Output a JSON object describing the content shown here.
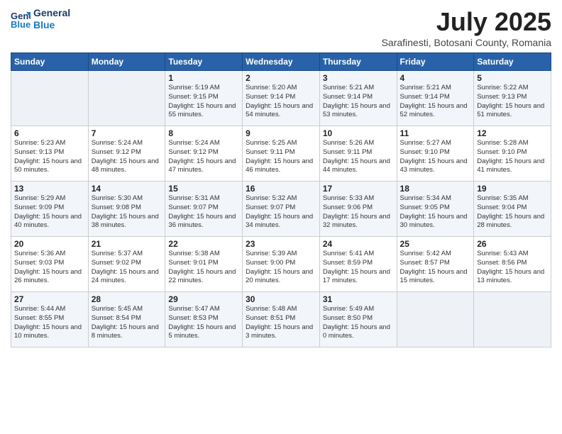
{
  "header": {
    "logo_line1": "General",
    "logo_line2": "Blue",
    "title": "July 2025",
    "location": "Sarafinesti, Botosani County, Romania"
  },
  "weekdays": [
    "Sunday",
    "Monday",
    "Tuesday",
    "Wednesday",
    "Thursday",
    "Friday",
    "Saturday"
  ],
  "weeks": [
    [
      {
        "day": null
      },
      {
        "day": null
      },
      {
        "day": "1",
        "sunrise": "Sunrise: 5:19 AM",
        "sunset": "Sunset: 9:15 PM",
        "daylight": "Daylight: 15 hours and 55 minutes."
      },
      {
        "day": "2",
        "sunrise": "Sunrise: 5:20 AM",
        "sunset": "Sunset: 9:14 PM",
        "daylight": "Daylight: 15 hours and 54 minutes."
      },
      {
        "day": "3",
        "sunrise": "Sunrise: 5:21 AM",
        "sunset": "Sunset: 9:14 PM",
        "daylight": "Daylight: 15 hours and 53 minutes."
      },
      {
        "day": "4",
        "sunrise": "Sunrise: 5:21 AM",
        "sunset": "Sunset: 9:14 PM",
        "daylight": "Daylight: 15 hours and 52 minutes."
      },
      {
        "day": "5",
        "sunrise": "Sunrise: 5:22 AM",
        "sunset": "Sunset: 9:13 PM",
        "daylight": "Daylight: 15 hours and 51 minutes."
      }
    ],
    [
      {
        "day": "6",
        "sunrise": "Sunrise: 5:23 AM",
        "sunset": "Sunset: 9:13 PM",
        "daylight": "Daylight: 15 hours and 50 minutes."
      },
      {
        "day": "7",
        "sunrise": "Sunrise: 5:24 AM",
        "sunset": "Sunset: 9:12 PM",
        "daylight": "Daylight: 15 hours and 48 minutes."
      },
      {
        "day": "8",
        "sunrise": "Sunrise: 5:24 AM",
        "sunset": "Sunset: 9:12 PM",
        "daylight": "Daylight: 15 hours and 47 minutes."
      },
      {
        "day": "9",
        "sunrise": "Sunrise: 5:25 AM",
        "sunset": "Sunset: 9:11 PM",
        "daylight": "Daylight: 15 hours and 46 minutes."
      },
      {
        "day": "10",
        "sunrise": "Sunrise: 5:26 AM",
        "sunset": "Sunset: 9:11 PM",
        "daylight": "Daylight: 15 hours and 44 minutes."
      },
      {
        "day": "11",
        "sunrise": "Sunrise: 5:27 AM",
        "sunset": "Sunset: 9:10 PM",
        "daylight": "Daylight: 15 hours and 43 minutes."
      },
      {
        "day": "12",
        "sunrise": "Sunrise: 5:28 AM",
        "sunset": "Sunset: 9:10 PM",
        "daylight": "Daylight: 15 hours and 41 minutes."
      }
    ],
    [
      {
        "day": "13",
        "sunrise": "Sunrise: 5:29 AM",
        "sunset": "Sunset: 9:09 PM",
        "daylight": "Daylight: 15 hours and 40 minutes."
      },
      {
        "day": "14",
        "sunrise": "Sunrise: 5:30 AM",
        "sunset": "Sunset: 9:08 PM",
        "daylight": "Daylight: 15 hours and 38 minutes."
      },
      {
        "day": "15",
        "sunrise": "Sunrise: 5:31 AM",
        "sunset": "Sunset: 9:07 PM",
        "daylight": "Daylight: 15 hours and 36 minutes."
      },
      {
        "day": "16",
        "sunrise": "Sunrise: 5:32 AM",
        "sunset": "Sunset: 9:07 PM",
        "daylight": "Daylight: 15 hours and 34 minutes."
      },
      {
        "day": "17",
        "sunrise": "Sunrise: 5:33 AM",
        "sunset": "Sunset: 9:06 PM",
        "daylight": "Daylight: 15 hours and 32 minutes."
      },
      {
        "day": "18",
        "sunrise": "Sunrise: 5:34 AM",
        "sunset": "Sunset: 9:05 PM",
        "daylight": "Daylight: 15 hours and 30 minutes."
      },
      {
        "day": "19",
        "sunrise": "Sunrise: 5:35 AM",
        "sunset": "Sunset: 9:04 PM",
        "daylight": "Daylight: 15 hours and 28 minutes."
      }
    ],
    [
      {
        "day": "20",
        "sunrise": "Sunrise: 5:36 AM",
        "sunset": "Sunset: 9:03 PM",
        "daylight": "Daylight: 15 hours and 26 minutes."
      },
      {
        "day": "21",
        "sunrise": "Sunrise: 5:37 AM",
        "sunset": "Sunset: 9:02 PM",
        "daylight": "Daylight: 15 hours and 24 minutes."
      },
      {
        "day": "22",
        "sunrise": "Sunrise: 5:38 AM",
        "sunset": "Sunset: 9:01 PM",
        "daylight": "Daylight: 15 hours and 22 minutes."
      },
      {
        "day": "23",
        "sunrise": "Sunrise: 5:39 AM",
        "sunset": "Sunset: 9:00 PM",
        "daylight": "Daylight: 15 hours and 20 minutes."
      },
      {
        "day": "24",
        "sunrise": "Sunrise: 5:41 AM",
        "sunset": "Sunset: 8:59 PM",
        "daylight": "Daylight: 15 hours and 17 minutes."
      },
      {
        "day": "25",
        "sunrise": "Sunrise: 5:42 AM",
        "sunset": "Sunset: 8:57 PM",
        "daylight": "Daylight: 15 hours and 15 minutes."
      },
      {
        "day": "26",
        "sunrise": "Sunrise: 5:43 AM",
        "sunset": "Sunset: 8:56 PM",
        "daylight": "Daylight: 15 hours and 13 minutes."
      }
    ],
    [
      {
        "day": "27",
        "sunrise": "Sunrise: 5:44 AM",
        "sunset": "Sunset: 8:55 PM",
        "daylight": "Daylight: 15 hours and 10 minutes."
      },
      {
        "day": "28",
        "sunrise": "Sunrise: 5:45 AM",
        "sunset": "Sunset: 8:54 PM",
        "daylight": "Daylight: 15 hours and 8 minutes."
      },
      {
        "day": "29",
        "sunrise": "Sunrise: 5:47 AM",
        "sunset": "Sunset: 8:53 PM",
        "daylight": "Daylight: 15 hours and 5 minutes."
      },
      {
        "day": "30",
        "sunrise": "Sunrise: 5:48 AM",
        "sunset": "Sunset: 8:51 PM",
        "daylight": "Daylight: 15 hours and 3 minutes."
      },
      {
        "day": "31",
        "sunrise": "Sunrise: 5:49 AM",
        "sunset": "Sunset: 8:50 PM",
        "daylight": "Daylight: 15 hours and 0 minutes."
      },
      {
        "day": null
      },
      {
        "day": null
      }
    ]
  ]
}
